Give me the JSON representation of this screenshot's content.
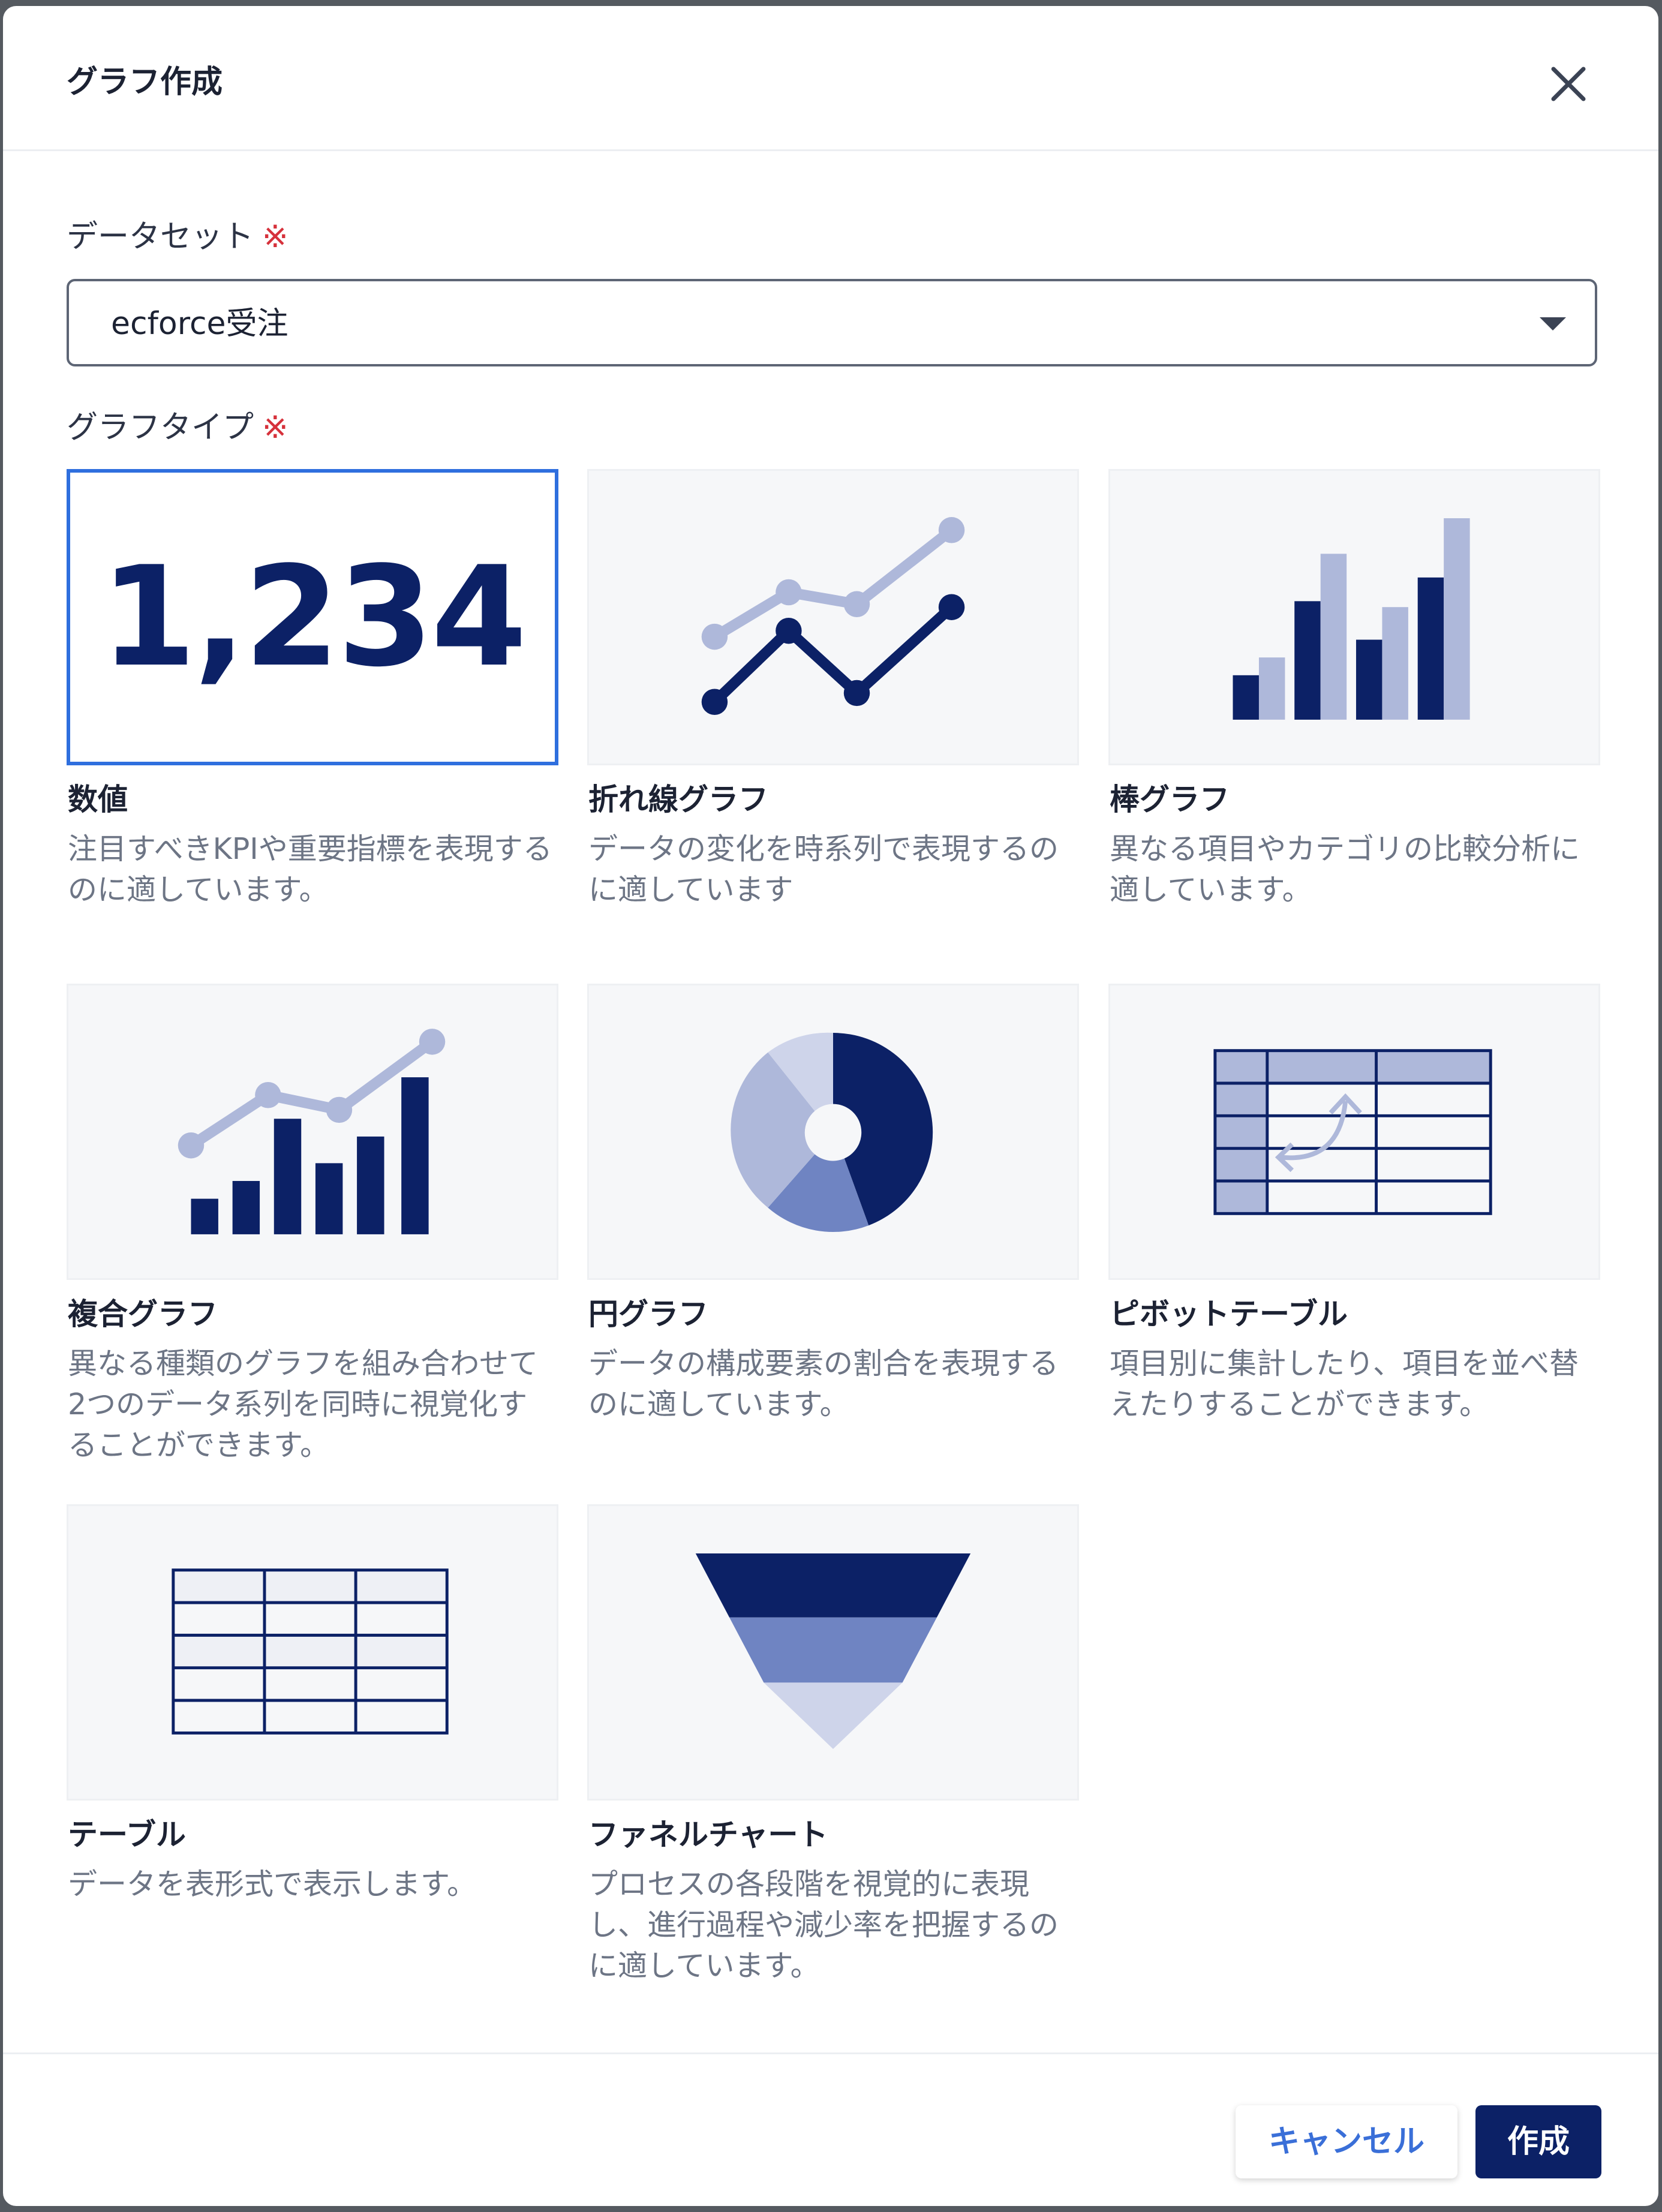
{
  "dialog": {
    "title": "グラフ作成"
  },
  "dataset": {
    "label": "データセット",
    "required_mark": "※",
    "value": "ecforce受注"
  },
  "graph_type": {
    "label": "グラフタイプ",
    "required_mark": "※",
    "selected": "数値",
    "options": [
      {
        "name": "数値",
        "description": "注目すべきKPIや重要指標を表現するのに適しています。",
        "sample_value": "1,234",
        "icon": "number-icon"
      },
      {
        "name": "折れ線グラフ",
        "description": "データの変化を時系列で表現するのに適しています",
        "icon": "line-chart-icon"
      },
      {
        "name": "棒グラフ",
        "description": "異なる項目やカテゴリの比較分析に適しています。",
        "icon": "bar-chart-icon"
      },
      {
        "name": "複合グラフ",
        "description": "異なる種類のグラフを組み合わせて2つのデータ系列を同時に視覚化することができます。",
        "icon": "combo-chart-icon"
      },
      {
        "name": "円グラフ",
        "description": "データの構成要素の割合を表現するのに適しています。",
        "icon": "pie-chart-icon"
      },
      {
        "name": "ピボットテーブル",
        "description": "項目別に集計したり、項目を並べ替えたりすることができます。",
        "icon": "pivot-table-icon"
      },
      {
        "name": "テーブル",
        "description": "データを表形式で表示します。",
        "icon": "table-icon"
      },
      {
        "name": "ファネルチャート",
        "description": "プロセスの各段階を視覚的に表現し、進行過程や減少率を把握するのに適しています。",
        "icon": "funnel-chart-icon"
      }
    ]
  },
  "footer": {
    "cancel_label": "キャンセル",
    "create_label": "作成"
  },
  "colors": {
    "accent": "#0c2166",
    "accent_light": "#aeb8da",
    "accent_mid": "#6f84c2",
    "selected_border": "#2f6fde",
    "required": "#d6313b"
  }
}
